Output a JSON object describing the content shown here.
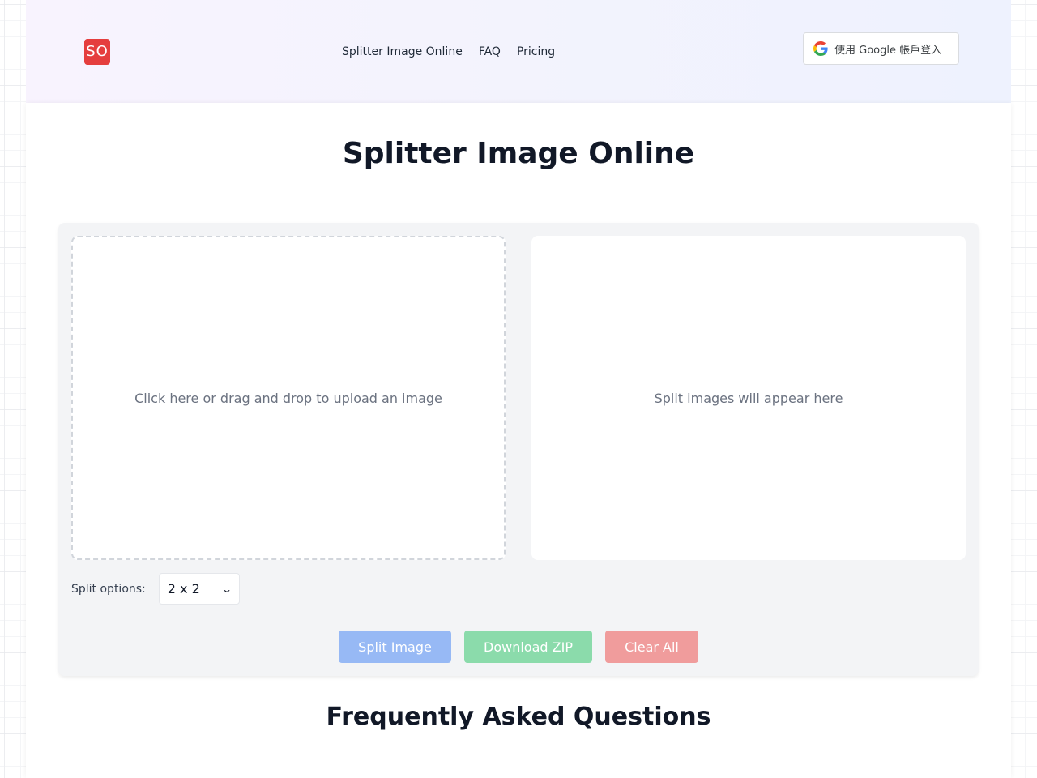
{
  "header": {
    "logo_text": "SO",
    "nav": [
      {
        "label": "Splitter Image Online"
      },
      {
        "label": "FAQ"
      },
      {
        "label": "Pricing"
      }
    ],
    "google_signin_label": "使用 Google 帳戶登入",
    "google_icon": "google-g-icon"
  },
  "main": {
    "title": "Splitter Image Online",
    "upload_placeholder": "Click here or drag and drop to upload an image",
    "result_placeholder": "Split images will appear here",
    "split_options_label": "Split options:",
    "split_selected": "2 x 2",
    "buttons": {
      "split": "Split Image",
      "download": "Download ZIP",
      "clear": "Clear All"
    },
    "faq_title": "Frequently Asked Questions"
  },
  "colors": {
    "logo": "#e53e3e",
    "split_button": "#97b9f5",
    "download_button": "#8bdbab",
    "clear_button": "#f09c9c"
  }
}
